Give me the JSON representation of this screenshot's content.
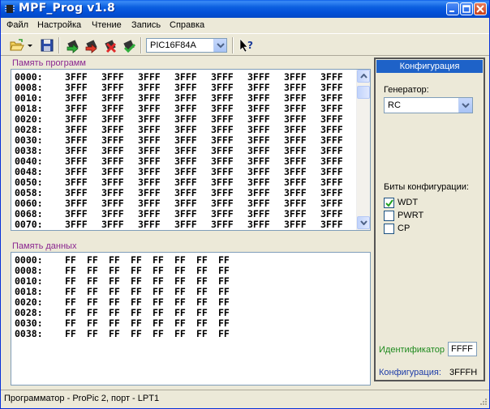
{
  "title": "MPF_Prog v1.8",
  "menu": [
    "Файл",
    "Настройка",
    "Чтение",
    "Запись",
    "Справка"
  ],
  "toolbar": {
    "chip": "PIC16F84A"
  },
  "program_memory": {
    "label": "Память программ",
    "rows": [
      {
        "addr": "0000:",
        "values": [
          "3FFF",
          "3FFF",
          "3FFF",
          "3FFF",
          "3FFF",
          "3FFF",
          "3FFF",
          "3FFF"
        ]
      },
      {
        "addr": "0008:",
        "values": [
          "3FFF",
          "3FFF",
          "3FFF",
          "3FFF",
          "3FFF",
          "3FFF",
          "3FFF",
          "3FFF"
        ]
      },
      {
        "addr": "0010:",
        "values": [
          "3FFF",
          "3FFF",
          "3FFF",
          "3FFF",
          "3FFF",
          "3FFF",
          "3FFF",
          "3FFF"
        ]
      },
      {
        "addr": "0018:",
        "values": [
          "3FFF",
          "3FFF",
          "3FFF",
          "3FFF",
          "3FFF",
          "3FFF",
          "3FFF",
          "3FFF"
        ]
      },
      {
        "addr": "0020:",
        "values": [
          "3FFF",
          "3FFF",
          "3FFF",
          "3FFF",
          "3FFF",
          "3FFF",
          "3FFF",
          "3FFF"
        ]
      },
      {
        "addr": "0028:",
        "values": [
          "3FFF",
          "3FFF",
          "3FFF",
          "3FFF",
          "3FFF",
          "3FFF",
          "3FFF",
          "3FFF"
        ]
      },
      {
        "addr": "0030:",
        "values": [
          "3FFF",
          "3FFF",
          "3FFF",
          "3FFF",
          "3FFF",
          "3FFF",
          "3FFF",
          "3FFF"
        ]
      },
      {
        "addr": "0038:",
        "values": [
          "3FFF",
          "3FFF",
          "3FFF",
          "3FFF",
          "3FFF",
          "3FFF",
          "3FFF",
          "3FFF"
        ]
      },
      {
        "addr": "0040:",
        "values": [
          "3FFF",
          "3FFF",
          "3FFF",
          "3FFF",
          "3FFF",
          "3FFF",
          "3FFF",
          "3FFF"
        ]
      },
      {
        "addr": "0048:",
        "values": [
          "3FFF",
          "3FFF",
          "3FFF",
          "3FFF",
          "3FFF",
          "3FFF",
          "3FFF",
          "3FFF"
        ]
      },
      {
        "addr": "0050:",
        "values": [
          "3FFF",
          "3FFF",
          "3FFF",
          "3FFF",
          "3FFF",
          "3FFF",
          "3FFF",
          "3FFF"
        ]
      },
      {
        "addr": "0058:",
        "values": [
          "3FFF",
          "3FFF",
          "3FFF",
          "3FFF",
          "3FFF",
          "3FFF",
          "3FFF",
          "3FFF"
        ]
      },
      {
        "addr": "0060:",
        "values": [
          "3FFF",
          "3FFF",
          "3FFF",
          "3FFF",
          "3FFF",
          "3FFF",
          "3FFF",
          "3FFF"
        ]
      },
      {
        "addr": "0068:",
        "values": [
          "3FFF",
          "3FFF",
          "3FFF",
          "3FFF",
          "3FFF",
          "3FFF",
          "3FFF",
          "3FFF"
        ]
      },
      {
        "addr": "0070:",
        "values": [
          "3FFF",
          "3FFF",
          "3FFF",
          "3FFF",
          "3FFF",
          "3FFF",
          "3FFF",
          "3FFF"
        ]
      }
    ]
  },
  "data_memory": {
    "label": "Память данных",
    "rows": [
      {
        "addr": "0000:",
        "values": [
          "FF",
          "FF",
          "FF",
          "FF",
          "FF",
          "FF",
          "FF",
          "FF"
        ]
      },
      {
        "addr": "0008:",
        "values": [
          "FF",
          "FF",
          "FF",
          "FF",
          "FF",
          "FF",
          "FF",
          "FF"
        ]
      },
      {
        "addr": "0010:",
        "values": [
          "FF",
          "FF",
          "FF",
          "FF",
          "FF",
          "FF",
          "FF",
          "FF"
        ]
      },
      {
        "addr": "0018:",
        "values": [
          "FF",
          "FF",
          "FF",
          "FF",
          "FF",
          "FF",
          "FF",
          "FF"
        ]
      },
      {
        "addr": "0020:",
        "values": [
          "FF",
          "FF",
          "FF",
          "FF",
          "FF",
          "FF",
          "FF",
          "FF"
        ]
      },
      {
        "addr": "0028:",
        "values": [
          "FF",
          "FF",
          "FF",
          "FF",
          "FF",
          "FF",
          "FF",
          "FF"
        ]
      },
      {
        "addr": "0030:",
        "values": [
          "FF",
          "FF",
          "FF",
          "FF",
          "FF",
          "FF",
          "FF",
          "FF"
        ]
      },
      {
        "addr": "0038:",
        "values": [
          "FF",
          "FF",
          "FF",
          "FF",
          "FF",
          "FF",
          "FF",
          "FF"
        ]
      }
    ]
  },
  "config": {
    "header": "Конфигурация",
    "generator_label": "Генератор:",
    "generator_value": "RC",
    "bits_label": "Биты конфигурации:",
    "bits": [
      {
        "name": "WDT",
        "checked": true
      },
      {
        "name": "PWRT",
        "checked": false
      },
      {
        "name": "CP",
        "checked": false
      }
    ],
    "identifier_label": "Идентификатор",
    "identifier_value": "FFFF",
    "config_label": "Конфигурация:",
    "config_value": "3FFFH"
  },
  "status": "Программатор - ProPic 2, порт - LPT1",
  "colors": {
    "section_label": "#8b2690",
    "identifier_label": "#1e8a1e",
    "config_label": "#1e3ca8",
    "title_bar": "#0350d8"
  },
  "icons": [
    "chip-app-icon",
    "open-folder-icon",
    "save-icon",
    "read-icon",
    "write-icon",
    "erase-icon",
    "verify-icon",
    "help-cursor-icon"
  ]
}
